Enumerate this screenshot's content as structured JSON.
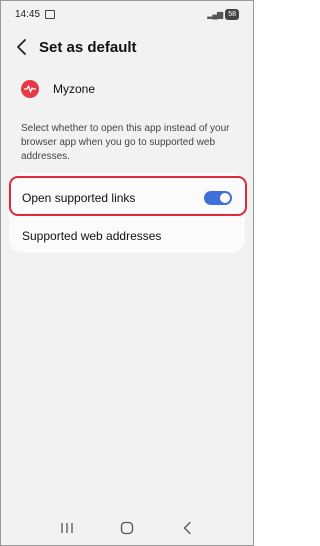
{
  "status_bar": {
    "time": "14:45",
    "battery": "58"
  },
  "header": {
    "title": "Set as default"
  },
  "app": {
    "name": "Myzone",
    "icon": "myzone-app-icon",
    "brand_color": "#e53946"
  },
  "description": "Select whether to open this app instead of your browser app when you go to supported web addresses.",
  "settings": {
    "open_links_label": "Open supported links",
    "open_links_enabled": true,
    "web_addresses_label": "Supported web addresses"
  },
  "colors": {
    "toggle_on": "#3f6fd9",
    "highlight": "#e0283c"
  },
  "icons": [
    "back-icon",
    "screenshot-icon",
    "signal-icon",
    "recents-icon",
    "home-icon",
    "nav-back-icon"
  ]
}
